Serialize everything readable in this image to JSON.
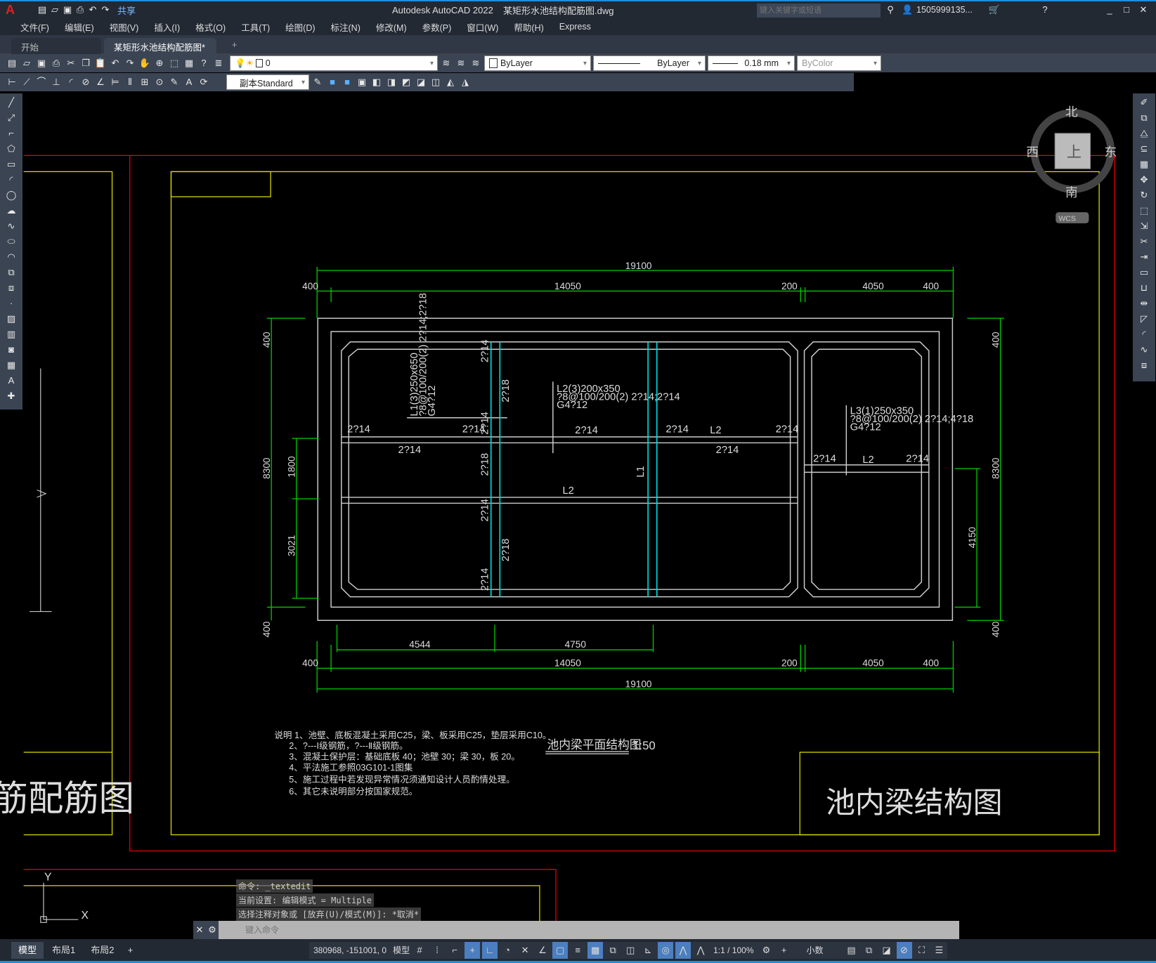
{
  "app": {
    "title": "Autodesk AutoCAD 2022",
    "filename": "某矩形水池结构配筋图.dwg",
    "share": "共享",
    "search_placeholder": "键入关键字或短语",
    "user": "1505999135...",
    "logo": "A"
  },
  "menu": [
    "文件(F)",
    "编辑(E)",
    "视图(V)",
    "插入(I)",
    "格式(O)",
    "工具(T)",
    "绘图(D)",
    "标注(N)",
    "修改(M)",
    "参数(P)",
    "窗口(W)",
    "帮助(H)",
    "Express"
  ],
  "tabs": [
    {
      "label": "开始",
      "active": false
    },
    {
      "label": "某矩形水池结构配筋图*",
      "active": true
    }
  ],
  "toolbar": {
    "layer": "0",
    "color": "ByLayer",
    "linetype": "ByLayer",
    "lineweight": "0.18 mm",
    "plotstyle": "ByColor",
    "dimstyle": "副本Standard"
  },
  "viewcube": {
    "north": "北",
    "south": "南",
    "east": "东",
    "west": "西",
    "top": "上",
    "wcs": "WCS"
  },
  "ucs": {
    "x": "X",
    "y": "Y"
  },
  "drawing": {
    "dims_top": {
      "total": "19100",
      "a": "400",
      "b": "14050",
      "c": "200",
      "d": "4050",
      "e": "400"
    },
    "dims_bottom": {
      "a1": "4544",
      "a2": "4750",
      "b1": "400",
      "b2": "14050",
      "b3": "200",
      "b4": "4050",
      "b5": "400",
      "total": "19100"
    },
    "dims_left": {
      "a": "400",
      "b": "8300",
      "c": "400",
      "d": "1800",
      "e": "3021"
    },
    "dims_right": {
      "a": "400",
      "b": "8300",
      "c": "400",
      "d": "4150"
    },
    "beam_L1": [
      "L1(3)250x650",
      "?8@100/200(2) 2?14;2?18",
      "G4?12"
    ],
    "beam_L2": [
      "L2(3)200x350",
      "?8@100/200(2) 2?14;2?14",
      "G4?12"
    ],
    "beam_L3": [
      "L3(1)250x350",
      "?8@100/200(2) 2?14;4?18",
      "G4?12"
    ],
    "rebar": "2?14",
    "rebar18": "2?18",
    "L1": "L1",
    "L2": "L2",
    "notes": [
      "说明 1、池壁、底板混凝土采用C25，梁、板采用C25，垫层采用C10。",
      "2、?---Ⅰ级钢筋，?---Ⅱ级钢筋。",
      "3、混凝土保护层：基础底板 40；池壁 30；梁 30，板 20。",
      "4、平法施工参照03G101-1图集",
      "5、施工过程中若发现异常情况须通知设计人员酌情处理。",
      "6、其它未说明部分按国家规范。"
    ],
    "plan_title": "池内梁平面结构图",
    "plan_scale": "1:50",
    "title_block": "池内梁结构图",
    "left_title": "筋配筋图"
  },
  "command": {
    "history": [
      "命令: _textedit",
      "当前设置: 编辑模式 = Multiple",
      "选择注释对象或 [放弃(U)/模式(M)]: *取消*"
    ],
    "placeholder": "键入命令"
  },
  "layout_tabs": [
    "模型",
    "布局1",
    "布局2"
  ],
  "status": {
    "coords": "380968, -151001, 0",
    "space": "模型",
    "scale": "1:1 / 100%",
    "units": "小数"
  }
}
